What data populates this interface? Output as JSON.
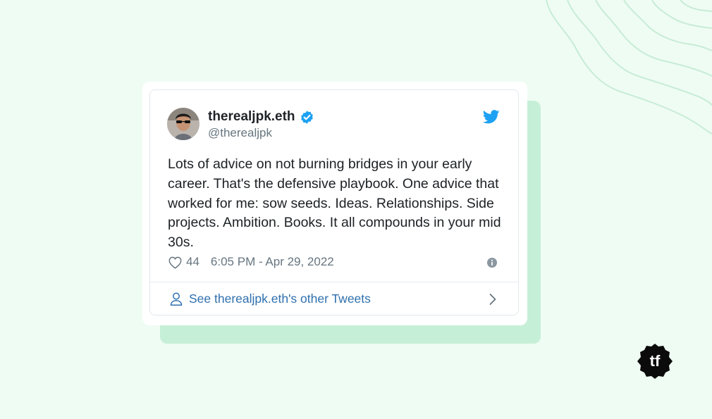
{
  "colors": {
    "background": "#effcf3",
    "card_shadow": "#c6efd7",
    "twitter_blue": "#1da1f2",
    "link_blue": "#2f70ad",
    "text_primary": "#1c2124",
    "text_secondary": "#66757f"
  },
  "tweet": {
    "author_name": "therealjpk.eth",
    "verified_icon": "verified-badge-icon",
    "handle": "@therealjpk",
    "brand_icon": "twitter-bird-icon",
    "text": "Lots of advice on not burning bridges in your early career. That's the defensive playbook. One advice that worked for me: sow seeds. Ideas. Relationships. Side projects. Ambition. Books. It all compounds in your mid 30s.",
    "like_icon": "heart-icon",
    "likes": "44",
    "timestamp": "6:05 PM - Apr 29, 2022",
    "info_icon": "info-icon",
    "footer": {
      "icon": "user-icon",
      "label": "See therealjpk.eth's other Tweets",
      "chevron_icon": "chevron-right-icon"
    }
  },
  "logo": {
    "text": "tf"
  }
}
